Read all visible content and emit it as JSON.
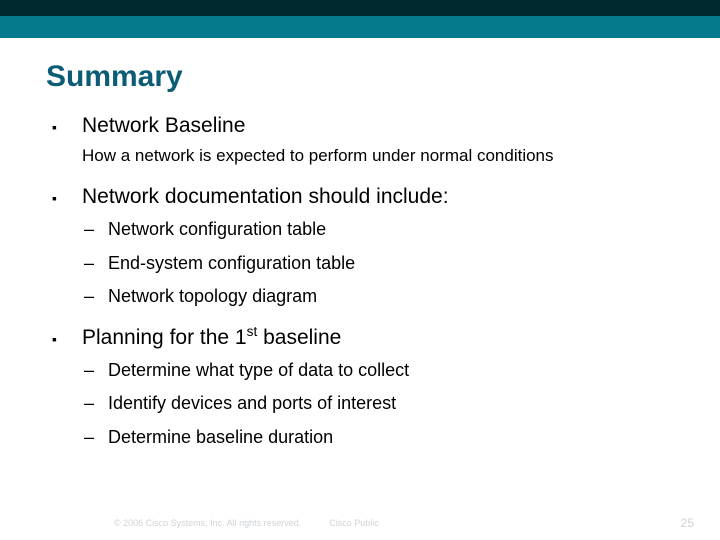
{
  "title": "Summary",
  "items": [
    {
      "text": "Network Baseline",
      "desc": "How a network is expected to perform under normal conditions"
    },
    {
      "text": "Network documentation should include:",
      "sub": [
        "Network configuration table",
        "End-system configuration table",
        "Network topology diagram"
      ]
    },
    {
      "text_html": "Planning for the 1<sup>st</sup> baseline",
      "sub": [
        "Determine what type of data to collect",
        "Identify devices and ports of interest",
        "Determine baseline duration"
      ]
    }
  ],
  "footer": {
    "copyright": "© 2006 Cisco Systems, Inc. All rights reserved.",
    "label": "Cisco Public",
    "page": "25"
  }
}
